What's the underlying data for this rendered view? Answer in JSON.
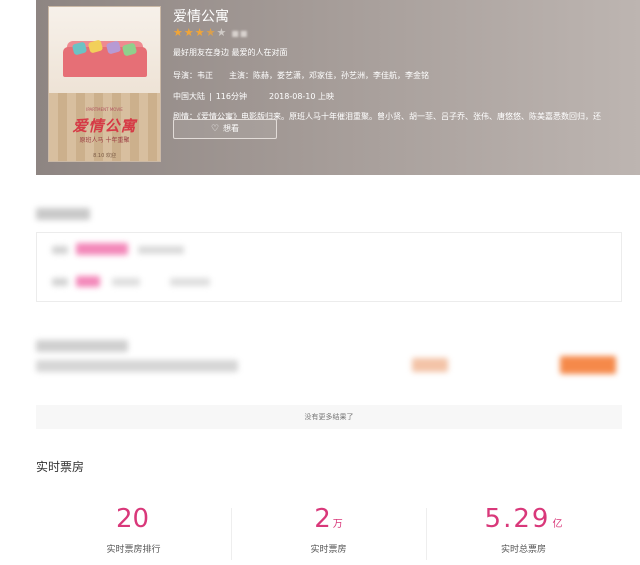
{
  "movie": {
    "title": "爱情公寓",
    "stars_on": "★★★",
    "star_half": "★",
    "stars_off": "★",
    "tagline": "最好朋友在身边 最爱的人在对面",
    "director_label": "导演：",
    "director": "韦正",
    "cast_label": "主演：",
    "cast": "陈赫，娄艺潇，邓家佳，孙艺洲，李佳航，李金铭",
    "region": "中国大陆",
    "duration": "116分钟",
    "release": "2018-08-10  上映",
    "plot_label": "剧情：",
    "plot": "《爱情公寓》电影版归来。原班人马十年催泪重聚。曾小贤、胡一菲、吕子乔、张伟、唐悠悠、陈美嘉悉数回归，还",
    "want_button": "想看",
    "poster": {
      "top_text": "IPARTMENT MOVIE",
      "title": "爱情公寓",
      "subtitle": "原班人马 十年重聚",
      "bottom_text": "8.10  欢迎"
    }
  },
  "list": {
    "no_more": "没有更多结果了"
  },
  "box_office": {
    "title": "实时票房",
    "stats": [
      {
        "value": "20",
        "unit": "",
        "label": "实时票房排行"
      },
      {
        "value": "2",
        "unit": "万",
        "label": "实时票房"
      },
      {
        "value": "5.29",
        "unit": "亿",
        "label": "实时总票房"
      }
    ]
  },
  "colors": {
    "accent": "#d9387a",
    "star": "#f1a537",
    "orange_button": "#f5894a",
    "pink_blur": "#f06aa8"
  }
}
